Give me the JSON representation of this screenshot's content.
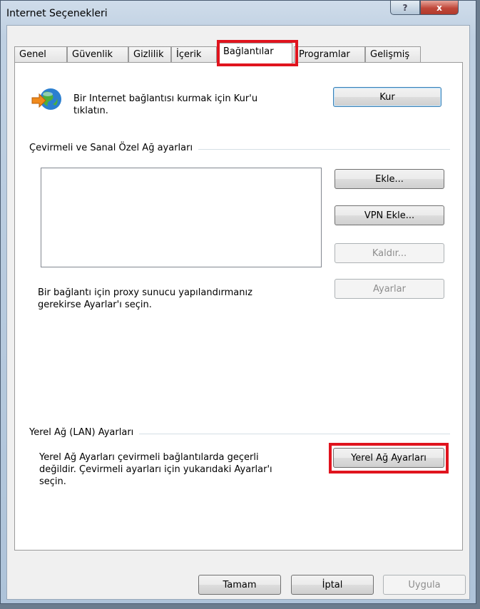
{
  "window": {
    "title": "Internet Seçenekleri",
    "help_label": "?",
    "close_label": "x"
  },
  "tabs": [
    {
      "label": "Genel"
    },
    {
      "label": "Güvenlik"
    },
    {
      "label": "Gizlilik"
    },
    {
      "label": "İçerik"
    },
    {
      "label": "Bağlantılar",
      "active": true
    },
    {
      "label": "Programlar"
    },
    {
      "label": "Gelişmiş"
    }
  ],
  "setup": {
    "text_line1": "Bir Internet bağlantısı kurmak için Kur'u",
    "text_line2": "tıklatın.",
    "button": "Kur",
    "icon": "globe-connection-icon"
  },
  "dialup": {
    "group_label": "Çevirmeli ve Sanal Özel Ağ ayarları",
    "add_button": "Ekle...",
    "add_vpn_button": "VPN Ekle...",
    "remove_button": "Kaldır...",
    "settings_button": "Ayarlar",
    "proxy_text_line1": "Bir bağlantı için proxy sunucu yapılandırmanız",
    "proxy_text_line2": "gerekirse Ayarlar'ı seçin."
  },
  "lan": {
    "group_label": "Yerel Ağ (LAN) Ayarları",
    "text_line1": "Yerel Ağ Ayarları çevirmeli bağlantılarda geçerli",
    "text_line2": "değildir. Çevirmeli ayarları için yukarıdaki Ayarlar'ı",
    "text_line3": "seçin.",
    "button": "Yerel Ağ Ayarları"
  },
  "footer": {
    "ok": "Tamam",
    "cancel": "İptal",
    "apply": "Uygula"
  },
  "colors": {
    "highlight": "#e0141e"
  }
}
